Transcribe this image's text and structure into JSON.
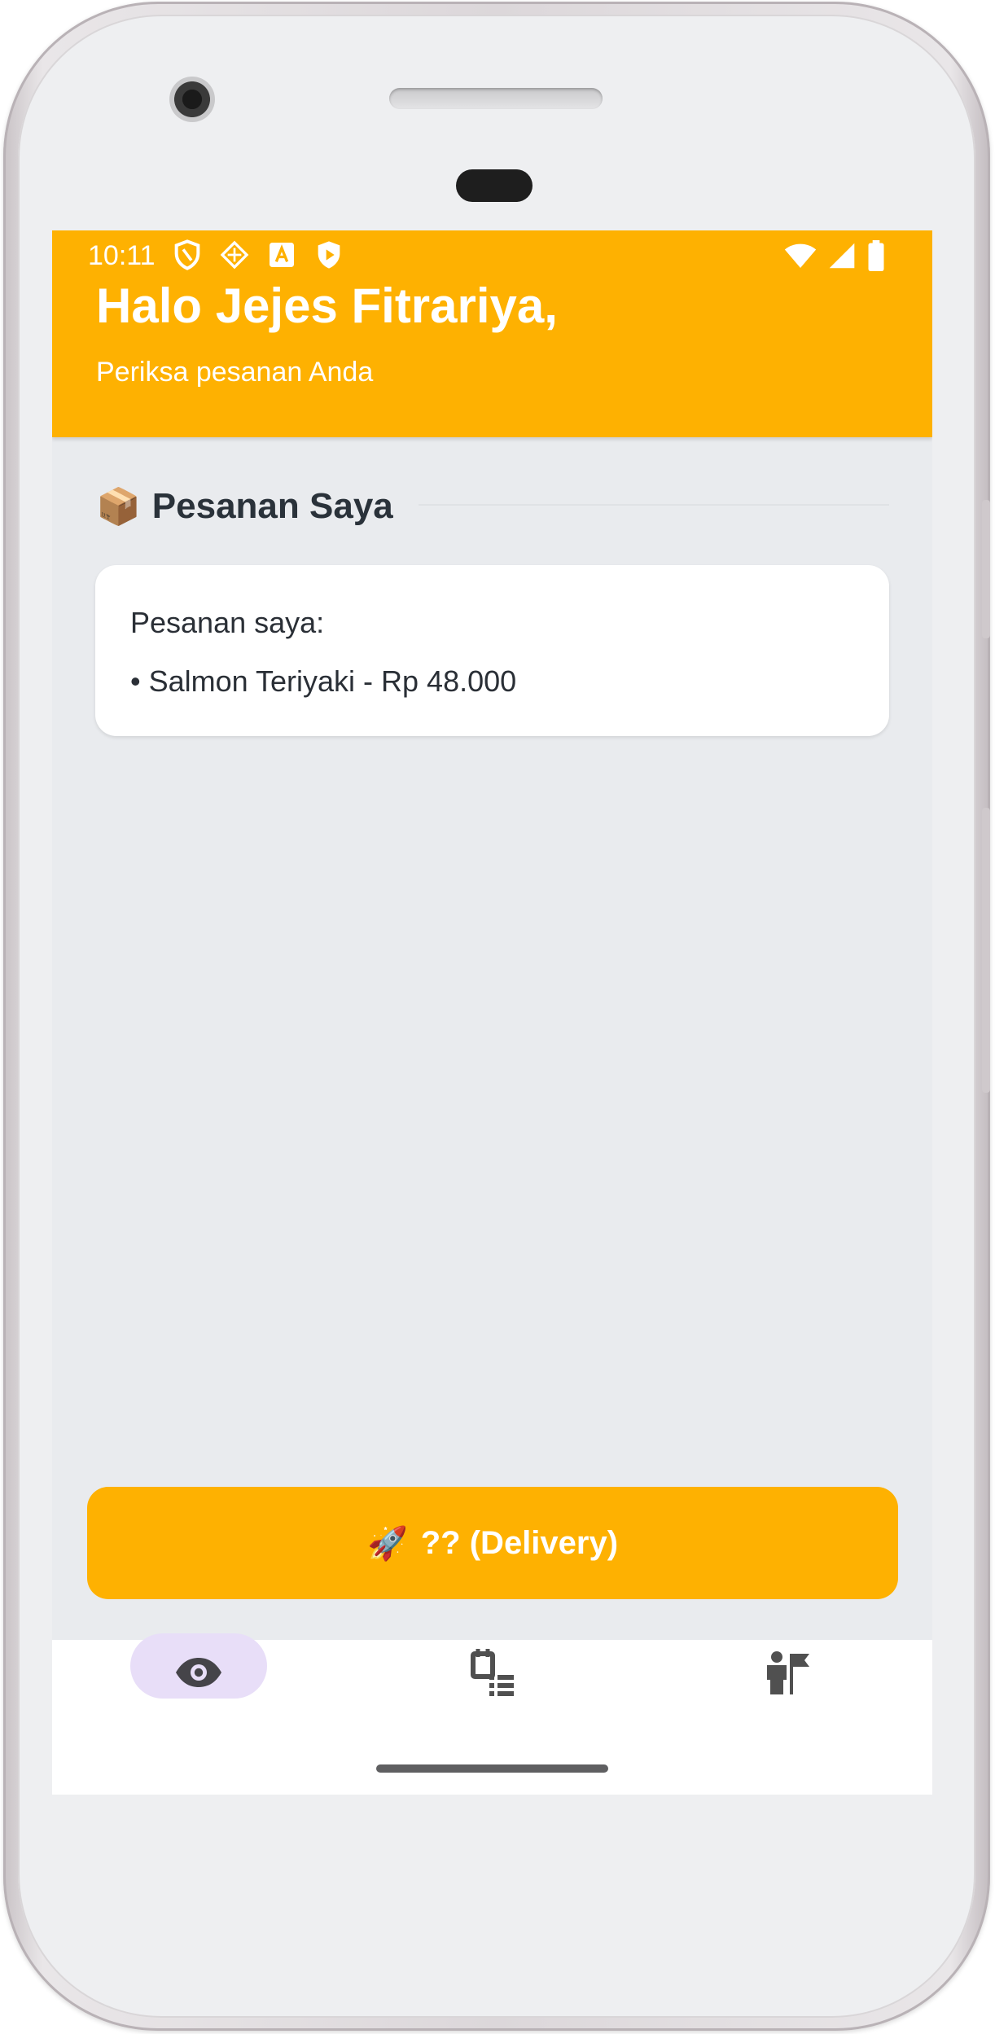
{
  "status_bar": {
    "time": "10:11",
    "left_icons": [
      "shield-outline-icon",
      "cast-icon",
      "text-a-icon",
      "play-shield-icon"
    ],
    "right_icons": [
      "wifi-icon",
      "signal-icon",
      "battery-icon"
    ]
  },
  "header": {
    "greeting": "Halo Jejes Fitrariya,",
    "subtitle": "Periksa pesanan Anda",
    "color": "#feb101"
  },
  "section": {
    "emoji": "📦",
    "title": "Pesanan Saya"
  },
  "order_card": {
    "title": "Pesanan saya:",
    "items": [
      "• Salmon Teriyaki - Rp 48.000"
    ]
  },
  "delivery_button": {
    "emoji": "🚀",
    "label": "?? (Delivery)"
  },
  "bottom_nav": {
    "items": [
      {
        "icon": "eye-icon",
        "active": true
      },
      {
        "icon": "order-list-icon",
        "active": false
      },
      {
        "icon": "person-flag-icon",
        "active": false
      }
    ],
    "active_pill_color": "#e8def8"
  }
}
